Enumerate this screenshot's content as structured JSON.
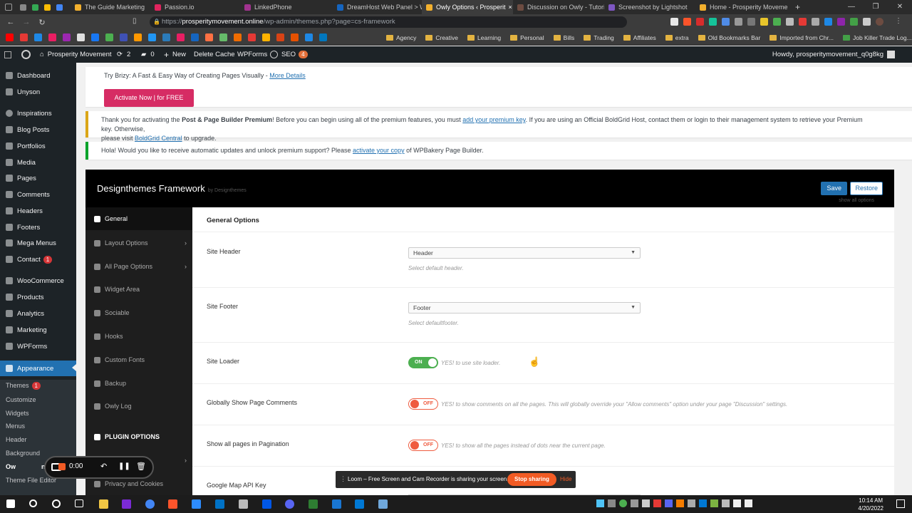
{
  "browser": {
    "tabs": [
      {
        "label": "The Guide Marketing",
        "color": "#f2b02e"
      },
      {
        "label": "Passion.io",
        "color": "#e0245e"
      },
      {
        "label": "LinkedPhone",
        "color": "#a1338f"
      },
      {
        "label": "DreamHost Web Panel > We",
        "color": "#1565c0"
      },
      {
        "label": "Owly Options ‹ Prosperit",
        "color": "#f2b02e"
      },
      {
        "label": "Discussion on Owly - Tutorin",
        "color": "#6d4c41"
      },
      {
        "label": "Screenshot by Lightshot",
        "color": "#7e57c2"
      },
      {
        "label": "Home - Prosperity Movemen",
        "color": "#f2b02e"
      }
    ],
    "active_tab_close": "×",
    "new_tab": "+",
    "url_prefix": "https://",
    "url_host": "prosperitymovement.online",
    "url_path": "/wp-admin/themes.php?page=cs-framework",
    "bookmarks": [
      "Agency",
      "Creative",
      "Learning",
      "Personal",
      "Bills",
      "Trading",
      "Affiliates",
      "extra",
      "Old Bookmarks Bar",
      "Imported from Chr...",
      "Job Killer Trade Log..."
    ]
  },
  "adminbar": {
    "site_name": "Prosperity Movement",
    "updates_count": "2",
    "comments_count": "0",
    "new_label": "New",
    "delete_cache": "Delete Cache",
    "wpforms": "WPForms",
    "seo": "SEO",
    "seo_badge": "4",
    "howdy": "Howdy, prosperitymovement_q0g8kg"
  },
  "sidebar": {
    "items": [
      {
        "label": "Dashboard"
      },
      {
        "label": "Unyson"
      },
      {
        "label": "Inspirations"
      },
      {
        "label": "Blog Posts"
      },
      {
        "label": "Portfolios"
      },
      {
        "label": "Media"
      },
      {
        "label": "Pages"
      },
      {
        "label": "Comments"
      },
      {
        "label": "Headers"
      },
      {
        "label": "Footers"
      },
      {
        "label": "Mega Menus"
      },
      {
        "label": "Contact",
        "badge": "1"
      },
      {
        "label": "WooCommerce"
      },
      {
        "label": "Products"
      },
      {
        "label": "Analytics"
      },
      {
        "label": "Marketing"
      },
      {
        "label": "WPForms"
      },
      {
        "label": "Appearance"
      }
    ],
    "submenu": {
      "themes": "Themes",
      "themes_badge": "1",
      "customize": "Customize",
      "widgets": "Widgets",
      "menus": "Menus",
      "header": "Header",
      "background": "Background",
      "owly": "Ow",
      "owly_tail": "ns",
      "theme_file_editor": "Theme File Editor"
    }
  },
  "notices": {
    "brizy_text": "Try Brizy: A Fast & Easy Way of Creating Pages Visually - ",
    "brizy_link": "More Details",
    "brizy_button": "Activate Now | for FREE",
    "boldgrid_pre": "Thank you for activating the ",
    "boldgrid_bold": "Post & Page Builder Premium",
    "boldgrid_mid": "! Before you can begin using all of the premium features, you must ",
    "boldgrid_link": "add your premium key",
    "boldgrid_post": ". If you are using an Official BoldGrid Host, contact them or login to their management system to retrieve your Premium key. Otherwise,",
    "boldgrid_line2_pre": "please visit ",
    "boldgrid_line2_link": "BoldGrid Central",
    "boldgrid_line2_post": " to upgrade.",
    "wpb_pre": "Hola! Would you like to receive automatic updates and unlock premium support? Please ",
    "wpb_link": "activate your copy",
    "wpb_post": " of WPBakery Page Builder."
  },
  "framework": {
    "title": "Designthemes Framework",
    "by": "by Designthemes",
    "save": "Save",
    "restore": "Restore",
    "show_all": "show all options",
    "nav": [
      "General",
      "Layout Options",
      "All Page Options",
      "Widget Area",
      "Sociable",
      "Hooks",
      "Custom Fonts",
      "Backup",
      "Owly Log",
      "PLUGIN OPTIONS",
      "Privacy and Cookies"
    ],
    "section_title": "General Options",
    "options": {
      "site_header_label": "Site Header",
      "site_header_value": "Header",
      "site_header_desc": "Select default header.",
      "site_footer_label": "Site Footer",
      "site_footer_value": "Footer",
      "site_footer_desc": "Select defaultfooter.",
      "site_loader_label": "Site Loader",
      "site_loader_state": "ON",
      "site_loader_desc": "YES! to use site loader.",
      "comments_label": "Globally Show Page Comments",
      "comments_state": "OFF",
      "comments_desc": "YES! to show comments on all the pages. This will globally override your \"Allow comments\" option under your page \"Discussion\" settings.",
      "pagination_label": "Show all pages in Pagination",
      "pagination_state": "OFF",
      "pagination_desc": "YES! to show all the pages instead of dots near the current page.",
      "gmap_label": "Google Map API Key"
    }
  },
  "loom": {
    "timer": "0:00",
    "bar_text": "Loom – Free Screen and Cam Recorder is sharing your screen.",
    "stop": "Stop sharing",
    "hide": "Hide"
  },
  "taskbar": {
    "time": "10:14 AM",
    "date": "4/20/2022"
  },
  "colors": {
    "wp_blue": "#2271b1",
    "wp_dark": "#1d2327",
    "toggle_on": "#4caf50",
    "toggle_off": "#ef5b3f",
    "brizy_pink": "#d62c64",
    "loom_orange": "#f25b24"
  }
}
